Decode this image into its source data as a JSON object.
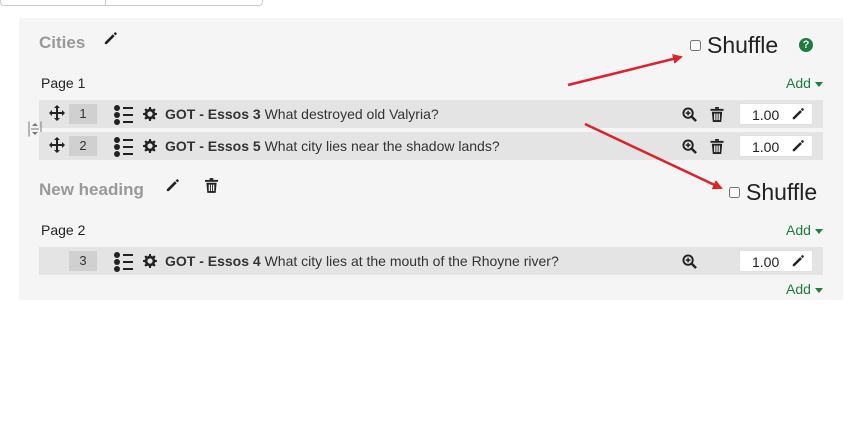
{
  "sections": [
    {
      "title": "Cities",
      "shuffle_label": "Shuffle",
      "help": "?",
      "page_label": "Page 1",
      "add_label": "Add",
      "slots": [
        {
          "number": "1",
          "question_name": "GOT - Essos 3",
          "question_text": "What destroyed old Valyria?",
          "mark": "1.00"
        },
        {
          "number": "2",
          "question_name": "GOT - Essos 5",
          "question_text": "What city lies near the shadow lands?",
          "mark": "1.00"
        }
      ]
    },
    {
      "title": "New heading",
      "shuffle_label": "Shuffle",
      "page_label": "Page 2",
      "add_label": "Add",
      "slots": [
        {
          "number": "3",
          "question_name": "GOT - Essos 4",
          "question_text": "What city lies at the mouth of the Rhoyne river?",
          "mark": "1.00"
        }
      ],
      "final_add_label": "Add"
    }
  ],
  "colors": {
    "accent": "#1a7f3c",
    "arrow": "#e0202a",
    "section_title": "#999999"
  },
  "icons": [
    "pencil-icon",
    "trash-icon",
    "help-icon",
    "move-icon",
    "list-icon",
    "gear-icon",
    "zoom-icon"
  ]
}
